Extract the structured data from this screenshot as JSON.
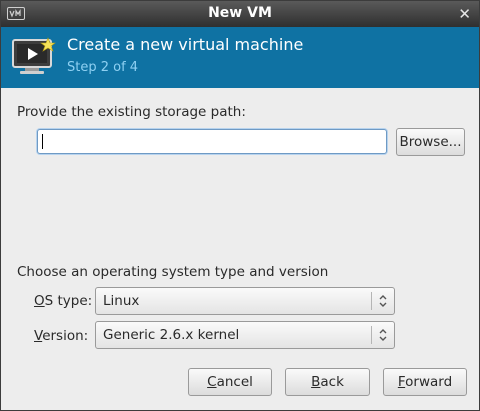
{
  "window": {
    "title": "New VM",
    "close_glyph": "✕"
  },
  "banner": {
    "heading": "Create a new virtual machine",
    "step": "Step 2 of 4",
    "icon": "virtual-machine-icon"
  },
  "storage": {
    "prompt": "Provide the existing storage path:",
    "path_value": "",
    "browse_label": "Browse..."
  },
  "os": {
    "section_label": "Choose an operating system type and version",
    "type_label_pre": "",
    "type_label_mn": "O",
    "type_label_post": "S type:",
    "type_value": "Linux",
    "version_label_pre": "",
    "version_label_mn": "V",
    "version_label_post": "ersion:",
    "version_value": "Generic 2.6.x kernel"
  },
  "buttons": {
    "cancel_mn": "C",
    "cancel_rest": "ancel",
    "back_mn": "B",
    "back_rest": "ack",
    "forward_mn": "F",
    "forward_rest": "orward"
  },
  "colors": {
    "banner": "#0f72a3",
    "step_text": "#8ed0f2",
    "titlebar": "#3a3a3a"
  }
}
